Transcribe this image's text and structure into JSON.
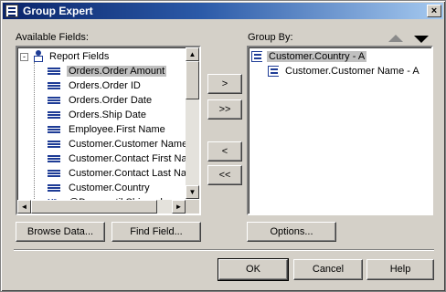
{
  "window": {
    "title": "Group Expert",
    "close_label": "×"
  },
  "available": {
    "label": "Available Fields:",
    "root": "Report Fields",
    "items": [
      "Orders.Order Amount",
      "Orders.Order ID",
      "Orders.Order Date",
      "Orders.Ship Date",
      "Employee.First Name",
      "Customer.Customer Name",
      "Customer.Contact First Nam",
      "Customer.Contact Last Nar",
      "Customer.Country",
      "@Days until Shipped"
    ]
  },
  "group_by": {
    "label": "Group By:",
    "items": [
      "Customer.Country - A",
      "Customer.Customer Name - A"
    ]
  },
  "move_buttons": {
    "add": ">",
    "add_all": ">>",
    "remove": "<",
    "remove_all": "<<"
  },
  "buttons": {
    "browse": "Browse Data...",
    "find": "Find Field...",
    "options": "Options...",
    "ok": "OK",
    "cancel": "Cancel",
    "help": "Help"
  },
  "scrollbar": {
    "up": "▲",
    "down": "▼",
    "left": "◄",
    "right": "►"
  }
}
